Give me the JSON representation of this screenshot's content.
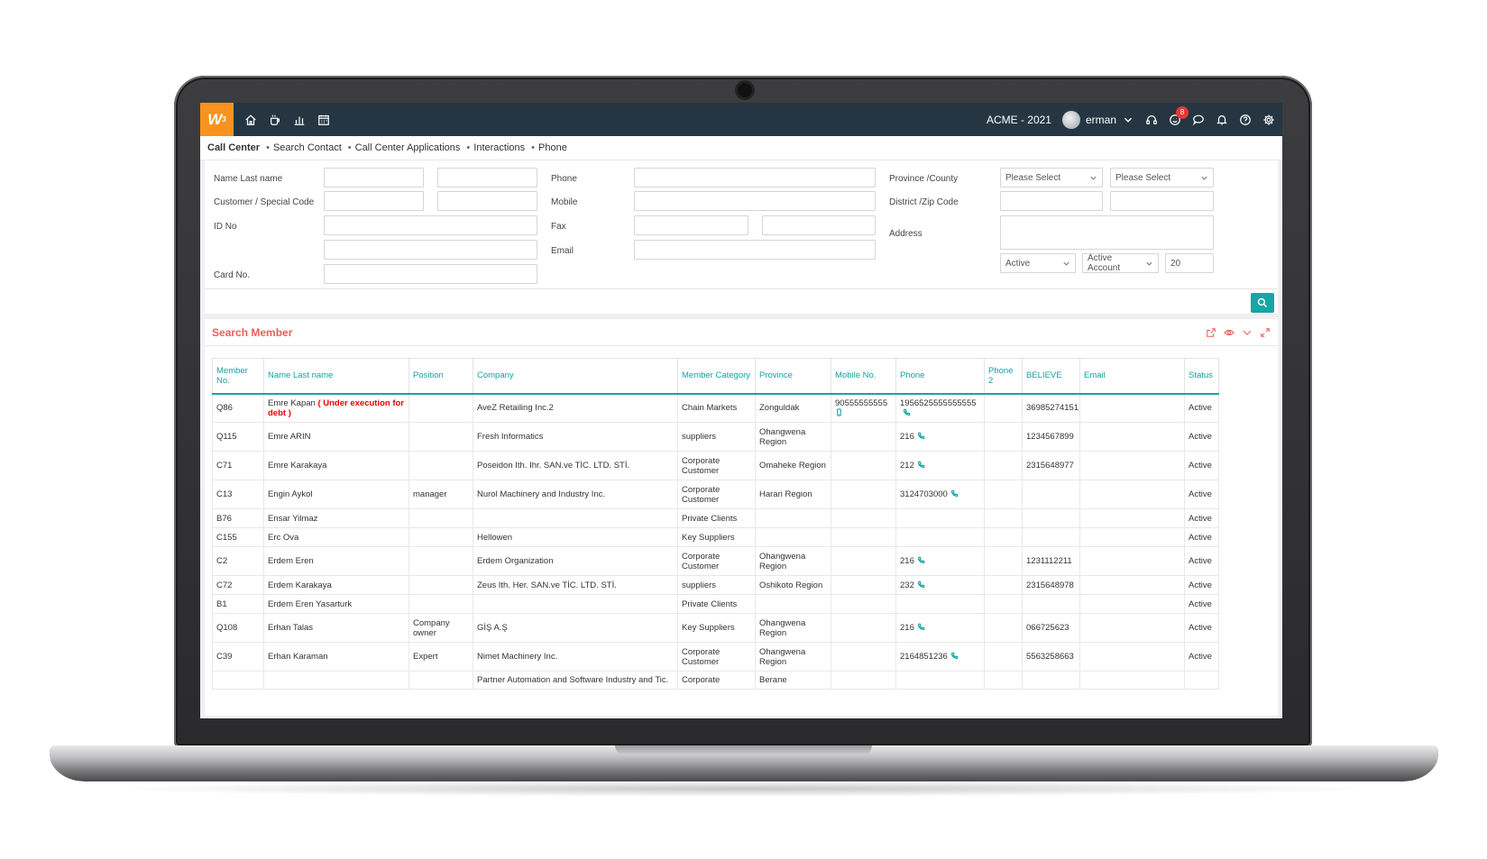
{
  "app": {
    "logo_text": "W",
    "logo_sup": "3",
    "company": "ACME - 2021",
    "user": "erman",
    "notification_count": "8",
    "nav_icons": [
      "home-icon",
      "coffee-icon",
      "chart-icon",
      "calendar-icon"
    ],
    "right_icons": [
      "headset-icon",
      "smiley-icon",
      "chat-icon",
      "bell-icon",
      "help-icon",
      "gear-icon"
    ]
  },
  "breadcrumb": [
    "Call Center",
    "Search Contact",
    "Call Center Applications",
    "Interactions",
    "Phone"
  ],
  "form": {
    "labels": {
      "name": "Name Last name",
      "customer_code": "Customer / Special Code",
      "id_no": "ID No",
      "card_no": "Card No.",
      "phone": "Phone",
      "mobile": "Mobile",
      "fax": "Fax",
      "email": "Email",
      "province": "Province /County",
      "district": "District /Zip Code",
      "address": "Address"
    },
    "selects": {
      "province": "Please Select",
      "county": "Please Select",
      "status": "Active",
      "account": "Active Account",
      "page_size": "20"
    }
  },
  "results": {
    "title": "Search Member",
    "columns": [
      "Member No.",
      "Name Last name",
      "Position",
      "Company",
      "Member Category",
      "Province",
      "Mobile No.",
      "Phone",
      "Phone 2",
      "BELIEVE",
      "Email",
      "Status"
    ],
    "rows": [
      {
        "no": "Q86",
        "name": "Emre Kapan",
        "note": "( Under execution for debt )",
        "position": "",
        "company": "AveZ Retailing Inc.2",
        "category": "Chain Markets",
        "province": "Zonguldak",
        "mobile": "90555555555",
        "phone": "1956525555555555",
        "phone2": "",
        "believe": "36985274151",
        "email": "",
        "status": "Active"
      },
      {
        "no": "Q115",
        "name": "Emre ARIN",
        "note": "",
        "position": "",
        "company": "Fresh Informatics",
        "category": "suppliers",
        "province": "Ohangwena Region",
        "mobile": "",
        "phone": "216",
        "phone2": "",
        "believe": "1234567899",
        "email": "",
        "status": "Active"
      },
      {
        "no": "C71",
        "name": "Emre Karakaya",
        "note": "",
        "position": "",
        "company": "Poseidon Ith. Ihr. SAN.ve TİC. LTD. STİ.",
        "category": "Corporate Customer",
        "province": "Omaheke Region",
        "mobile": "",
        "phone": "212",
        "phone2": "",
        "believe": "2315648977",
        "email": "",
        "status": "Active"
      },
      {
        "no": "C13",
        "name": "Engin Aykol",
        "note": "",
        "position": "manager",
        "company": "Nurol Machinery and Industry Inc.",
        "category": "Corporate Customer",
        "province": "Harari Region",
        "mobile": "",
        "phone": "3124703000",
        "phone2": "",
        "believe": "",
        "email": "",
        "status": "Active"
      },
      {
        "no": "B76",
        "name": "Ensar Yilmaz",
        "note": "",
        "position": "",
        "company": "",
        "category": "Private Clients",
        "province": "",
        "mobile": "",
        "phone": "",
        "phone2": "",
        "believe": "",
        "email": "",
        "status": "Active"
      },
      {
        "no": "C155",
        "name": "Erc Ova",
        "note": "",
        "position": "",
        "company": "Hellowen",
        "category": "Key Suppliers",
        "province": "",
        "mobile": "",
        "phone": "",
        "phone2": "",
        "believe": "",
        "email": "",
        "status": "Active"
      },
      {
        "no": "C2",
        "name": "Erdem Eren",
        "note": "",
        "position": "",
        "company": "Erdem Organization",
        "category": "Corporate Customer",
        "province": "Ohangwena Region",
        "mobile": "",
        "phone": "216",
        "phone2": "",
        "believe": "1231112211",
        "email": "",
        "status": "Active"
      },
      {
        "no": "C72",
        "name": "Erdem Karakaya",
        "note": "",
        "position": "",
        "company": "Zeus Ith. Her. SAN.ve TİC. LTD. STİ.",
        "category": "suppliers",
        "province": "Oshikoto Region",
        "mobile": "",
        "phone": "232",
        "phone2": "",
        "believe": "2315648978",
        "email": "",
        "status": "Active"
      },
      {
        "no": "B1",
        "name": "Erdem Eren Yasarturk",
        "note": "",
        "position": "",
        "company": "",
        "category": "Private Clients",
        "province": "",
        "mobile": "",
        "phone": "",
        "phone2": "",
        "believe": "",
        "email": "",
        "status": "Active"
      },
      {
        "no": "Q108",
        "name": "Erhan Talas",
        "note": "",
        "position": "Company owner",
        "company": "GİŞ A.Ş",
        "category": "Key Suppliers",
        "province": "Ohangwena Region",
        "mobile": "",
        "phone": "216",
        "phone2": "",
        "believe": "066725623",
        "email": "",
        "status": "Active"
      },
      {
        "no": "C39",
        "name": "Erhan Karaman",
        "note": "",
        "position": "Expert",
        "company": "Nimet Machinery Inc.",
        "category": "Corporate Customer",
        "province": "Ohangwena Region",
        "mobile": "",
        "phone": "2164851236",
        "phone2": "",
        "believe": "5563258663",
        "email": "",
        "status": "Active"
      },
      {
        "no": "",
        "name": "",
        "note": "",
        "position": "",
        "company": "Partner Automation and Software Industry and Tic.",
        "category": "Corporate",
        "province": "Berane",
        "mobile": "",
        "phone": "",
        "phone2": "",
        "believe": "",
        "email": "",
        "status": ""
      }
    ]
  },
  "colors": {
    "accent": "#17a5a5",
    "topbar": "#253642",
    "logo": "#f7931e",
    "title": "#e7615a",
    "debt": "#ee0000"
  }
}
